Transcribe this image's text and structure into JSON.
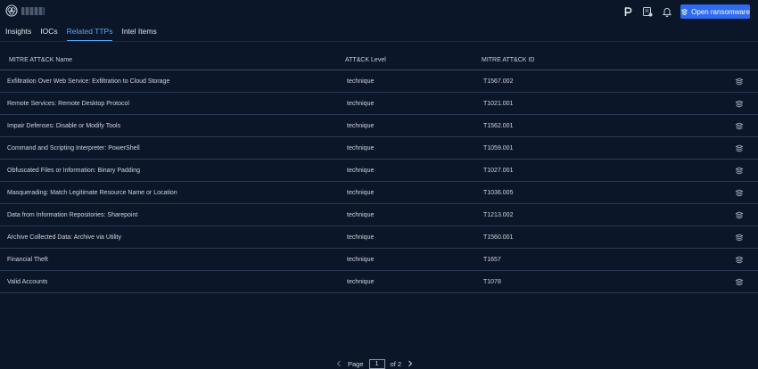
{
  "header": {
    "open_button_label": "Open ransomware",
    "icons": [
      "org-logo-icon",
      "p-badge-icon",
      "report-icon",
      "bell-icon",
      "ransomware-icon"
    ]
  },
  "tabs": [
    {
      "label": "Insights",
      "active": false
    },
    {
      "label": "IOCs",
      "active": false
    },
    {
      "label": "Related TTPs",
      "active": true
    },
    {
      "label": "Intel Items",
      "active": false
    }
  ],
  "table": {
    "columns": [
      "MITRE ATT&CK Name",
      "ATT&CK Level",
      "MITRE ATT&CK ID"
    ],
    "rows": [
      {
        "name": "Exfiltration Over Web Service: Exfiltration to Cloud Storage",
        "level": "technique",
        "id": "T1567.002"
      },
      {
        "name": "Remote Services: Remote Desktop Protocol",
        "level": "technique",
        "id": "T1021.001"
      },
      {
        "name": "Impair Defenses: Disable or Modify Tools",
        "level": "technique",
        "id": "T1562.001"
      },
      {
        "name": "Command and Scripting Interpreter: PowerShell",
        "level": "technique",
        "id": "T1059.001"
      },
      {
        "name": "Obfuscated Files or Information: Binary Padding",
        "level": "technique",
        "id": "T1027.001"
      },
      {
        "name": "Masquerading: Match Legitimate Resource Name or Location",
        "level": "technique",
        "id": "T1036.005"
      },
      {
        "name": "Data from Information Repositories: Sharepoint",
        "level": "technique",
        "id": "T1213.002"
      },
      {
        "name": "Archive Collected Data: Archive via Utility",
        "level": "technique",
        "id": "T1560.001"
      },
      {
        "name": "Financial Theft",
        "level": "technique",
        "id": "T1657"
      },
      {
        "name": "Valid Accounts",
        "level": "technique",
        "id": "T1078"
      }
    ]
  },
  "pagination": {
    "page_label": "Page",
    "current_page": "1",
    "total_label": "of 2"
  },
  "colors": {
    "background": "#0b1628",
    "accent": "#2f6bf0",
    "active_tab": "#5aa8ff",
    "row_border": "#2b3a53"
  }
}
